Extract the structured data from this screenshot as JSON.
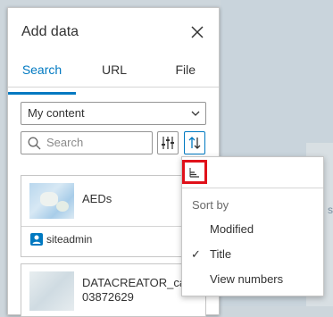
{
  "panel": {
    "title": "Add data",
    "tabs": [
      {
        "label": "Search",
        "active": true
      },
      {
        "label": "URL",
        "active": false
      },
      {
        "label": "File",
        "active": false
      }
    ],
    "content_select": {
      "value": "My content"
    },
    "search": {
      "placeholder": "Search"
    },
    "items": [
      {
        "title": "AEDs",
        "owner": "siteadmin"
      },
      {
        "title": "DATACREATOR_cas",
        "subtitle": "03872629"
      }
    ]
  },
  "sort_menu": {
    "heading": "Sort by",
    "options": [
      {
        "label": "Modified",
        "checked": false
      },
      {
        "label": "Title",
        "checked": true
      },
      {
        "label": "View numbers",
        "checked": false
      }
    ],
    "check_mark": "✓"
  },
  "colors": {
    "accent": "#0079c1",
    "highlight": "#e0111a"
  }
}
